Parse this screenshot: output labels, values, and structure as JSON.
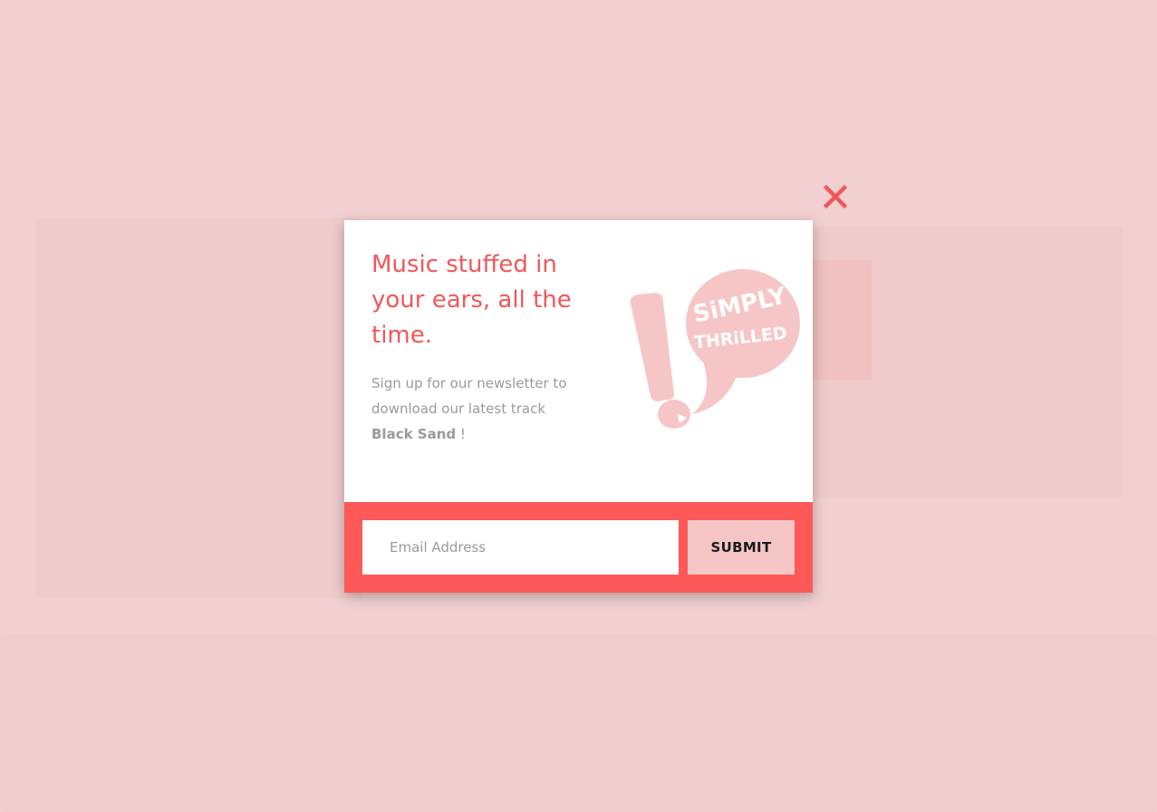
{
  "overlay": {
    "color": "#f2d0d1"
  },
  "close_button": {
    "icon": "close-icon",
    "color": "#f0575a"
  },
  "modal": {
    "headline": "Music stuffed in your ears, all the time.",
    "body_prefix": "Sign up for our newsletter to download our latest track",
    "track_name": "Black Sand",
    "body_suffix": " !",
    "logo_text": "SIMPLY THRILLED",
    "headline_color": "#f0575a",
    "footer_color": "#fe5859"
  },
  "form": {
    "email_placeholder": "Email Address",
    "email_value": "",
    "submit_label": "SUBMIT",
    "submit_bg": "#f6c6c7"
  }
}
